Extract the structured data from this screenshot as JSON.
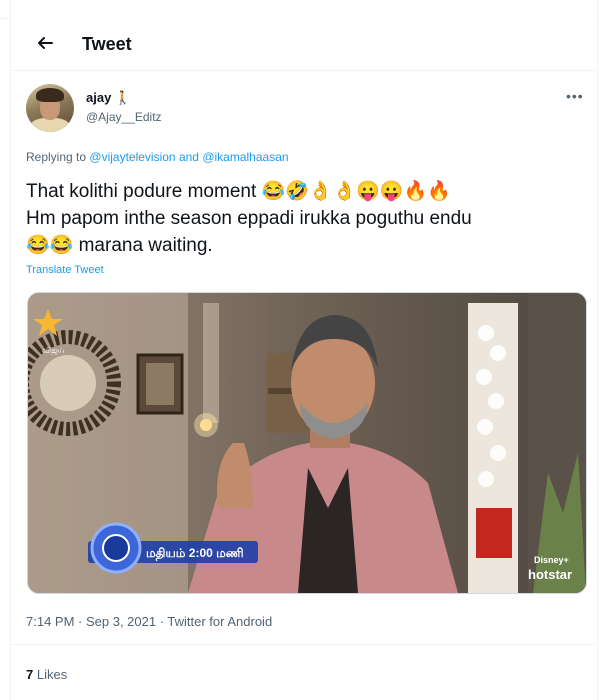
{
  "header": {
    "back_icon": "arrow-left-icon",
    "title": "Tweet"
  },
  "author": {
    "name": "ajay 🚶",
    "handle": "@Ajay__Editz",
    "avatar_icon": "user-avatar"
  },
  "more_icon": "more-horizontal-icon",
  "replying": {
    "prefix": "Replying to",
    "user1": "@vijaytelevision",
    "joiner": "and",
    "user2": "@ikamalhaasan"
  },
  "tweet": {
    "line1": "That kolithi podure moment 😂🤣👌👌😛😛🔥🔥",
    "line2": "Hm papom inthe season eppadi irukka poguthu endu",
    "line3": "😂😂 marana waiting."
  },
  "translate_label": "Translate Tweet",
  "media": {
    "channel_badge": "விஜய்",
    "schedule_text": "மதியம் 2:00 மணி",
    "brand_top": "Disney+",
    "brand_bottom": "hotstar"
  },
  "meta": "7:14 PM · Sep 3, 2021 · Twitter for Android",
  "likes": {
    "count": "7",
    "label": "Likes"
  },
  "colors": {
    "link": "#1d9bf0",
    "secondary_text": "#536471",
    "primary_text": "#0f1419"
  }
}
